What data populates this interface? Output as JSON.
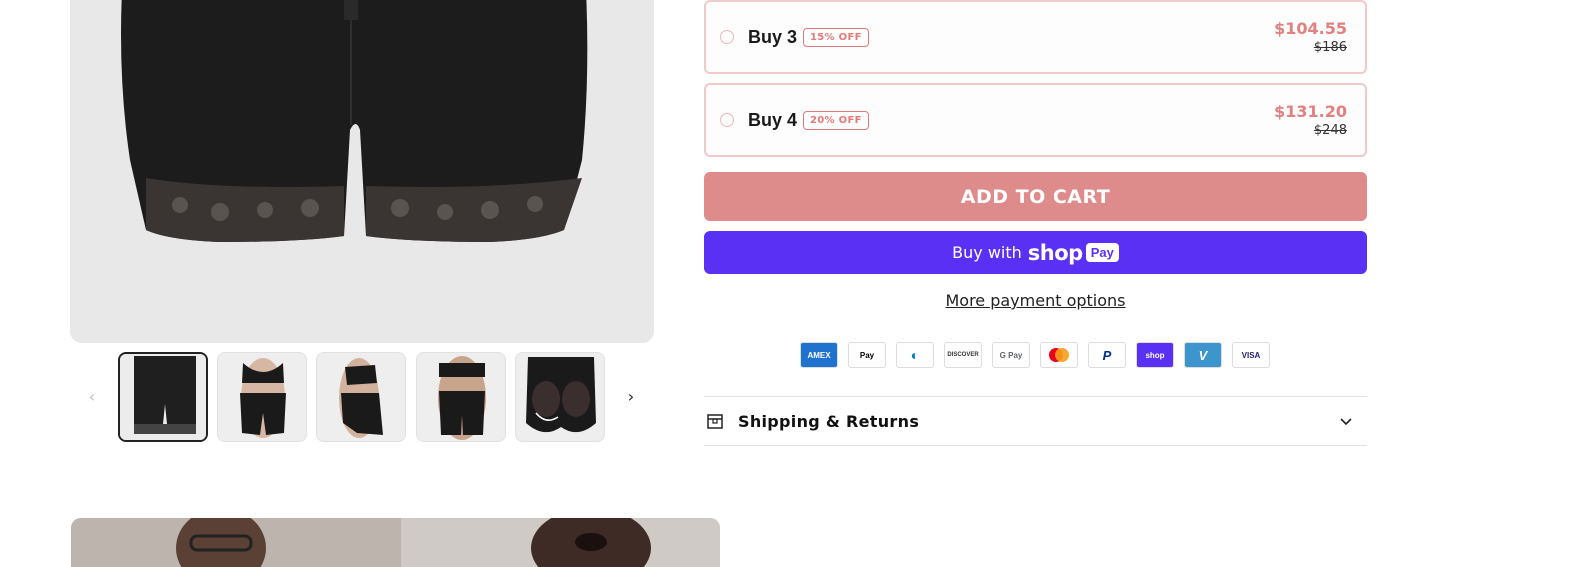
{
  "gallery": {
    "thumbnails": [
      {
        "name": "front-view",
        "active": true
      },
      {
        "name": "model-front",
        "active": false
      },
      {
        "name": "model-side",
        "active": false
      },
      {
        "name": "model-back",
        "active": false
      },
      {
        "name": "butt-lift",
        "active": false
      }
    ],
    "prev_icon": "‹",
    "next_icon": "›"
  },
  "offers": [
    {
      "label": "Buy 3",
      "badge": "15% OFF",
      "price": "$104.55",
      "compare": "$186"
    },
    {
      "label": "Buy 4",
      "badge": "20% OFF",
      "price": "$131.20",
      "compare": "$248"
    }
  ],
  "buttons": {
    "add_to_cart": "ADD TO CART",
    "buy_with": "Buy with",
    "shop_word": "shop",
    "pay_word": "Pay",
    "more_options": "More payment options"
  },
  "payment_icons": [
    {
      "name": "amex-icon",
      "text": "AMEX",
      "bg": "#1f72cd",
      "fg": "#ffffff"
    },
    {
      "name": "apple-pay-icon",
      "text": "Pay",
      "bg": "#ffffff",
      "fg": "#000000"
    },
    {
      "name": "diners-icon",
      "text": "◐",
      "bg": "#ffffff",
      "fg": "#0079be"
    },
    {
      "name": "discover-icon",
      "text": "DISCOVER",
      "bg": "#ffffff",
      "fg": "#333333"
    },
    {
      "name": "google-pay-icon",
      "text": "G Pay",
      "bg": "#ffffff",
      "fg": "#5f6368"
    },
    {
      "name": "mastercard-icon",
      "text": "",
      "bg": "#ffffff",
      "fg": "#000000"
    },
    {
      "name": "paypal-icon",
      "text": "P",
      "bg": "#ffffff",
      "fg": "#003087"
    },
    {
      "name": "shop-pay-icon",
      "text": "shop",
      "bg": "#5a31f4",
      "fg": "#ffffff"
    },
    {
      "name": "venmo-icon",
      "text": "V",
      "bg": "#3d95ce",
      "fg": "#ffffff"
    },
    {
      "name": "visa-icon",
      "text": "VISA",
      "bg": "#ffffff",
      "fg": "#1a1f71"
    }
  ],
  "accordion": {
    "title": "Shipping & Returns"
  },
  "colors": {
    "accent": "#de8b8b",
    "shop_pay": "#5a31f4",
    "price": "#e08080"
  }
}
